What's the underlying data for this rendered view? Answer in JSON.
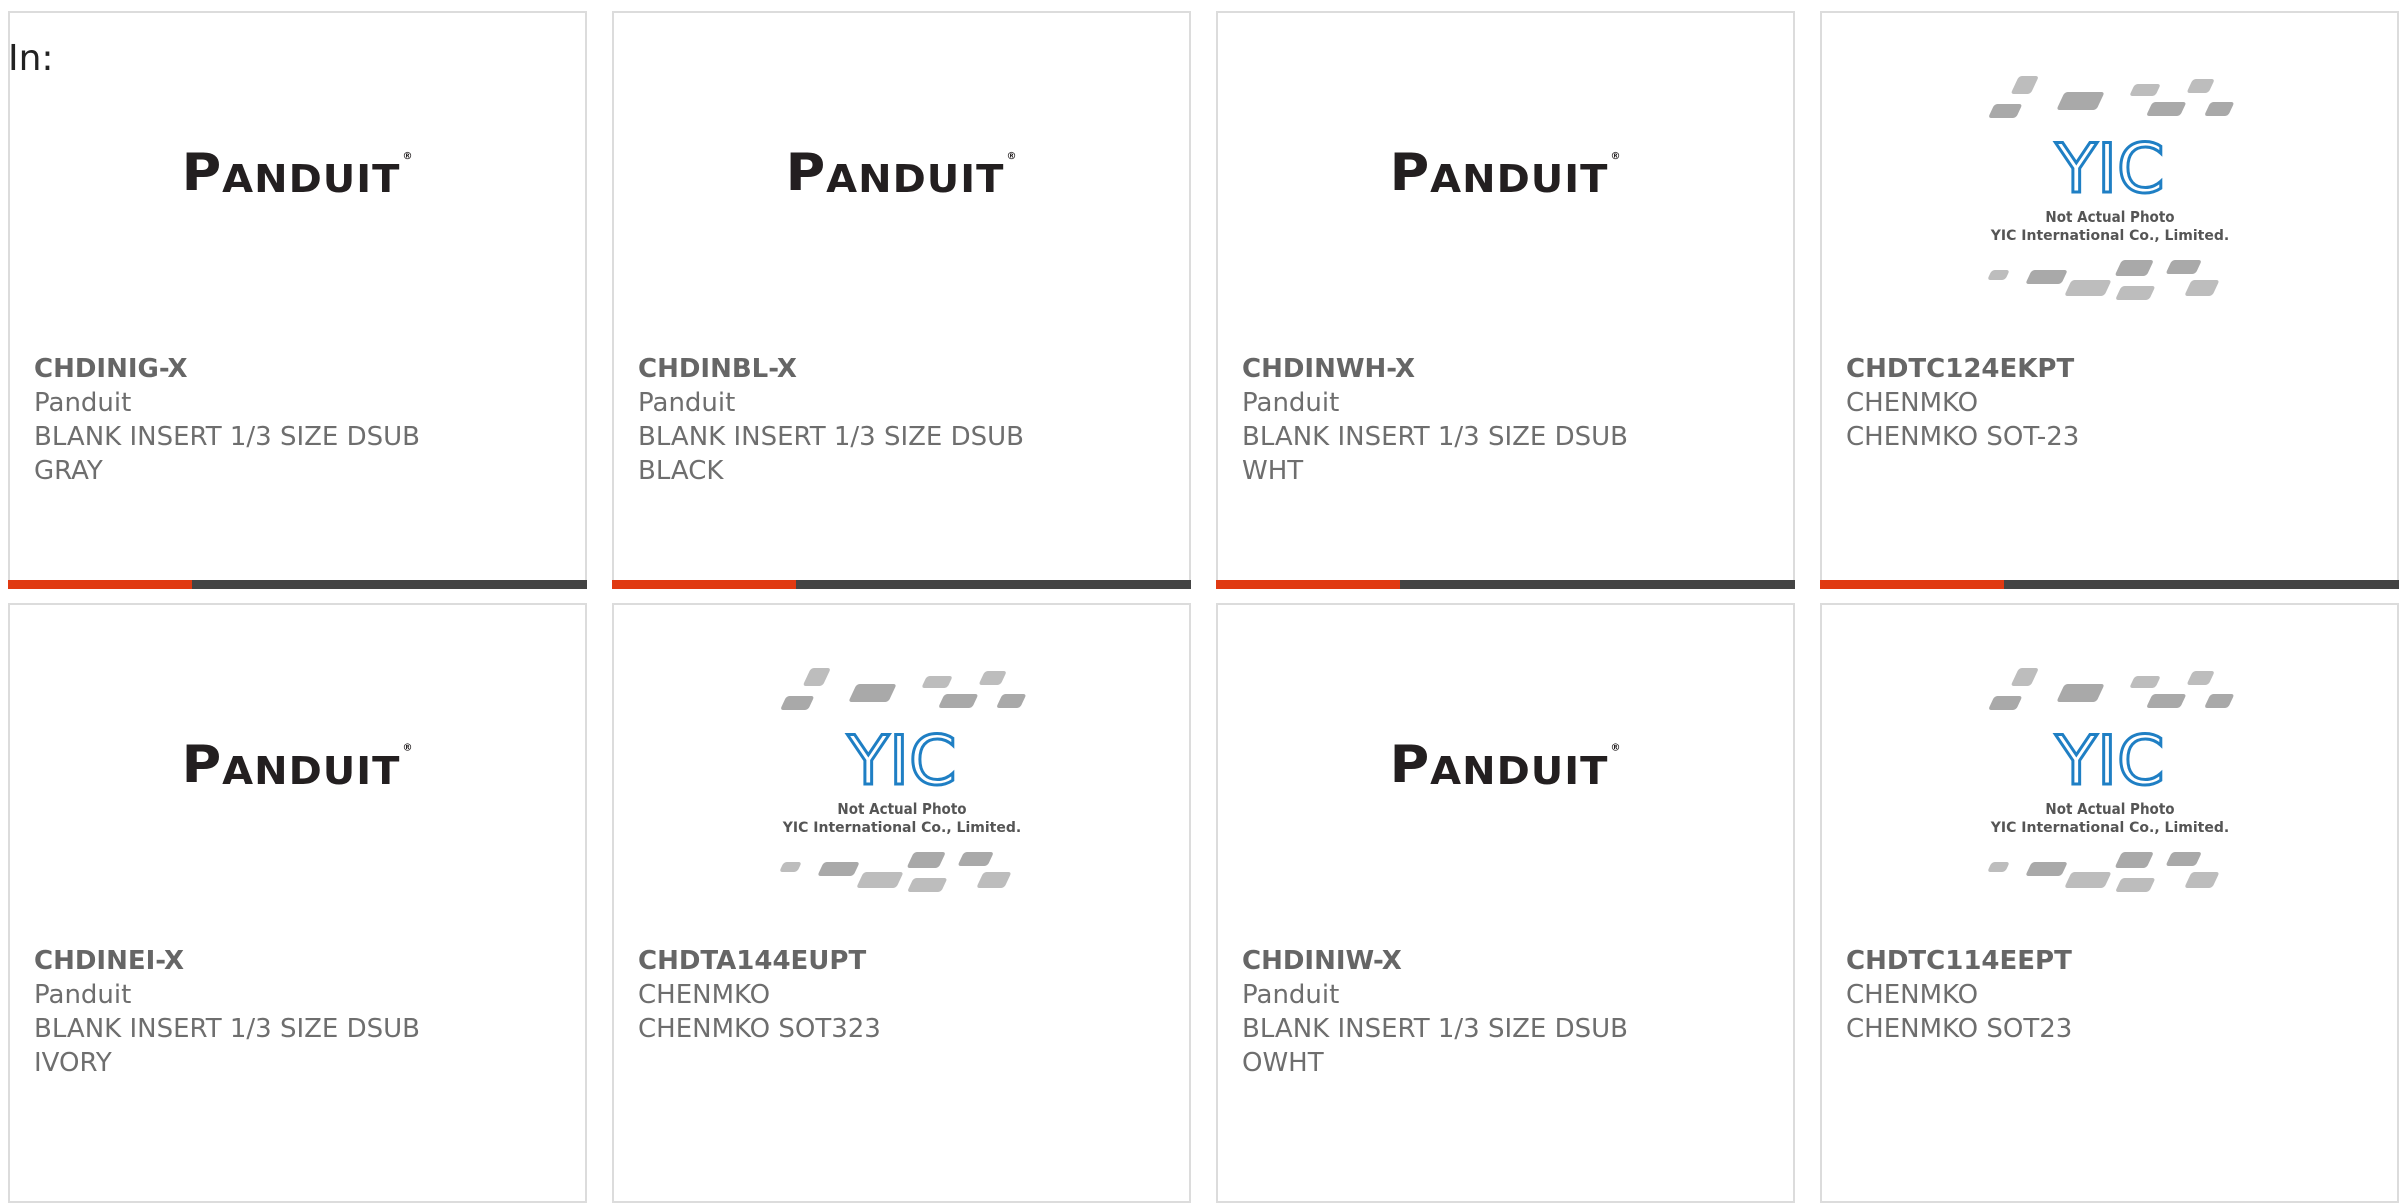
{
  "page": {
    "label": "In:"
  },
  "colors": {
    "accent": "#e03a12",
    "bar": "#444444",
    "text": "#6e6e6e",
    "yic_blue": "#1f7fc4"
  },
  "products": [
    {
      "part": "CHDINIG-X",
      "maker": "Panduit",
      "desc1": "BLANK INSERT 1/3 SIZE DSUB",
      "desc2": "GRAY",
      "image": "panduit-logo"
    },
    {
      "part": "CHDINBL-X",
      "maker": "Panduit",
      "desc1": "BLANK INSERT 1/3 SIZE DSUB",
      "desc2": "BLACK",
      "image": "panduit-logo"
    },
    {
      "part": "CHDINWH-X",
      "maker": "Panduit",
      "desc1": "BLANK INSERT 1/3 SIZE DSUB",
      "desc2": "WHT",
      "image": "panduit-logo"
    },
    {
      "part": "CHDTC124EKPT",
      "maker": "CHENMKO",
      "desc1": "CHENMKO SOT-23",
      "desc2": "",
      "image": "yic-placeholder"
    },
    {
      "part": "CHDINEI-X",
      "maker": "Panduit",
      "desc1": "BLANK INSERT 1/3 SIZE DSUB",
      "desc2": "IVORY",
      "image": "panduit-logo"
    },
    {
      "part": "CHDTA144EUPT",
      "maker": "CHENMKO",
      "desc1": "CHENMKO SOT323",
      "desc2": "",
      "image": "yic-placeholder"
    },
    {
      "part": "CHDINIW-X",
      "maker": "Panduit",
      "desc1": "BLANK INSERT 1/3 SIZE DSUB",
      "desc2": "OWHT",
      "image": "panduit-logo"
    },
    {
      "part": "CHDTC114EEPT",
      "maker": "CHENMKO",
      "desc1": "CHENMKO SOT23",
      "desc2": "",
      "image": "yic-placeholder"
    }
  ],
  "logos": {
    "panduit": {
      "first": "P",
      "rest": "ANDUIT",
      "mark": "®"
    },
    "yic": {
      "mark": "YIC",
      "line1": "Not Actual Photo",
      "line2": "YIC International Co., Limited."
    }
  }
}
